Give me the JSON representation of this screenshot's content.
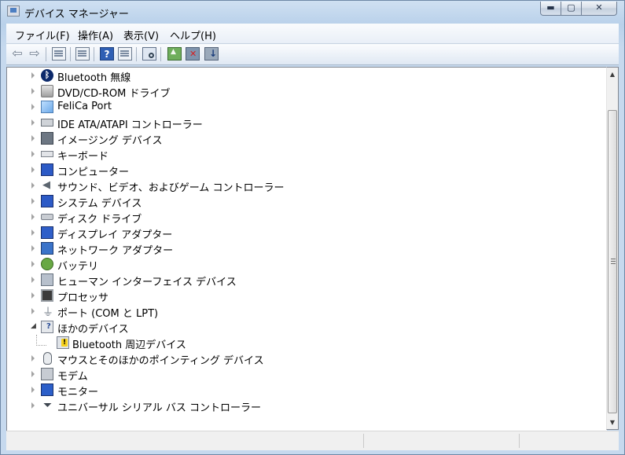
{
  "window": {
    "title": "デバイス マネージャー"
  },
  "title_buttons": {
    "minimize": "▬",
    "maximize": "▢",
    "close": "✕"
  },
  "menu": [
    "ファイル(F)",
    "操作(A)",
    "表示(V)",
    "ヘルプ(H)"
  ],
  "toolbar": {
    "buttons": [
      "back-icon",
      "forward-icon",
      "show-hide-console-tree-icon",
      "properties-icon",
      "help-icon",
      "view-icon",
      "scan-hardware-icon",
      "update-driver-icon",
      "disable-device-icon",
      "uninstall-device-icon"
    ],
    "back_glyph": "⇦",
    "forward_glyph": "⇨",
    "help_glyph": "?"
  },
  "tree": {
    "items": [
      {
        "label": "Bluetooth 無線",
        "icon": "bluetooth-icon",
        "expanded": false
      },
      {
        "label": "DVD/CD-ROM ドライブ",
        "icon": "dvd-drive-icon",
        "expanded": false
      },
      {
        "label": "FeliCa Port",
        "icon": "felica-icon",
        "expanded": false
      },
      {
        "label": "IDE ATA/ATAPI コントローラー",
        "icon": "ide-controller-icon",
        "expanded": false
      },
      {
        "label": "イメージング デバイス",
        "icon": "camera-icon",
        "expanded": false
      },
      {
        "label": "キーボード",
        "icon": "keyboard-icon",
        "expanded": false
      },
      {
        "label": "コンピューター",
        "icon": "computer-icon",
        "expanded": false
      },
      {
        "label": "サウンド、ビデオ、およびゲーム コントローラー",
        "icon": "speaker-icon",
        "expanded": false
      },
      {
        "label": "システム デバイス",
        "icon": "system-device-icon",
        "expanded": false
      },
      {
        "label": "ディスク ドライブ",
        "icon": "disk-drive-icon",
        "expanded": false
      },
      {
        "label": "ディスプレイ アダプター",
        "icon": "display-adapter-icon",
        "expanded": false
      },
      {
        "label": "ネットワーク アダプター",
        "icon": "network-adapter-icon",
        "expanded": false
      },
      {
        "label": "バッテリ",
        "icon": "battery-icon",
        "expanded": false
      },
      {
        "label": "ヒューマン インターフェイス デバイス",
        "icon": "hid-icon",
        "expanded": false
      },
      {
        "label": "プロセッサ",
        "icon": "processor-icon",
        "expanded": false
      },
      {
        "label": "ポート (COM と LPT)",
        "icon": "port-icon",
        "expanded": false
      },
      {
        "label": "ほかのデバイス",
        "icon": "other-devices-icon",
        "expanded": true
      },
      {
        "label": "Bluetooth 周辺デバイス",
        "icon": "warning-device-icon",
        "child": true
      },
      {
        "label": "マウスとそのほかのポインティング デバイス",
        "icon": "mouse-icon",
        "expanded": false
      },
      {
        "label": "モデム",
        "icon": "modem-icon",
        "expanded": false
      },
      {
        "label": "モニター",
        "icon": "monitor-icon",
        "expanded": false
      },
      {
        "label": "ユニバーサル シリアル バス コントローラー",
        "icon": "usb-icon",
        "expanded": false
      }
    ]
  },
  "scrollbar": {
    "up": "▲",
    "down": "▼"
  },
  "statusbar": {
    "panels": [
      "",
      "",
      ""
    ]
  }
}
